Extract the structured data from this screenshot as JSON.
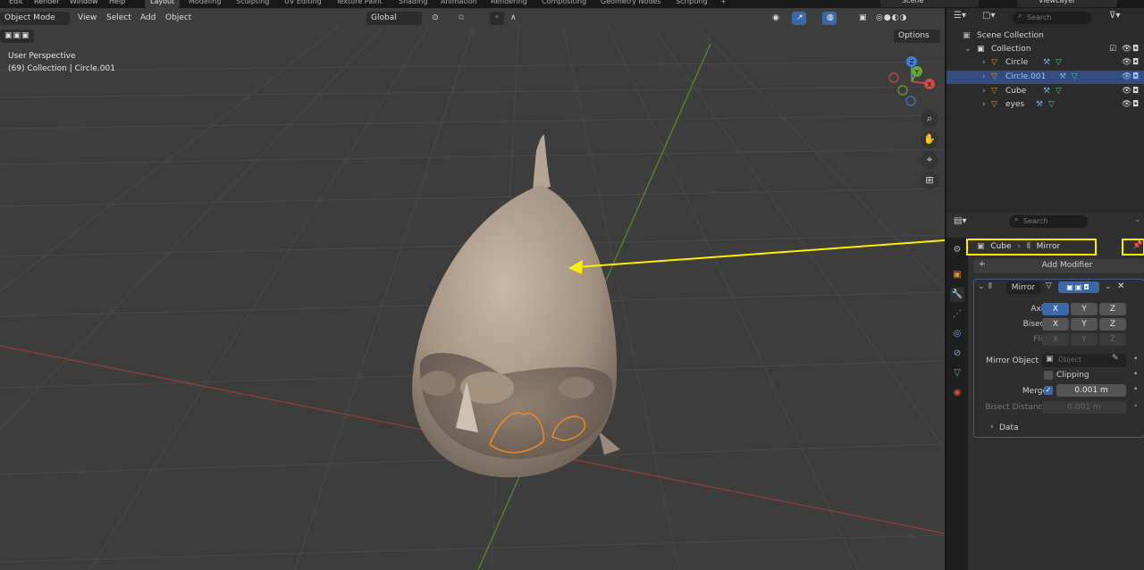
{
  "topbar": {
    "menus": [
      "Edit",
      "Render",
      "Window",
      "Help"
    ],
    "workspaces": [
      "Layout",
      "Modeling",
      "Sculpting",
      "UV Editing",
      "Texture Paint",
      "Shading",
      "Animation",
      "Rendering",
      "Compositing",
      "Geometry Nodes",
      "Scripting",
      "+"
    ],
    "scene": "Scene",
    "view_layer": "ViewLayer"
  },
  "viewport_header": {
    "mode": "Object Mode",
    "menus": [
      "View",
      "Select",
      "Add",
      "Object"
    ],
    "orientation": "Global",
    "options": "Options"
  },
  "viewport_overlay": {
    "perspective": "User Perspective",
    "collection_info": "(69) Collection | Circle.001"
  },
  "gizmo": {
    "x": "X",
    "y": "Y",
    "z": "Z"
  },
  "outliner": {
    "search_placeholder": "Search",
    "scene_collection": "Scene Collection",
    "collection": "Collection",
    "objects": [
      "Circle",
      "Circle.001",
      "Cube",
      "eyes"
    ],
    "selected": "Circle.001"
  },
  "properties": {
    "search_placeholder": "Search",
    "breadcrumb": {
      "object": "Cube",
      "modifier": "Mirror"
    },
    "add_modifier": "Add Modifier",
    "modifier": {
      "name": "Mirror",
      "axis_label": "Axis",
      "bisect_label": "Bisect",
      "flip_label": "Flip",
      "axes": [
        "X",
        "Y",
        "Z"
      ],
      "mirror_object_label": "Mirror Object",
      "mirror_object_placeholder": "Object",
      "clipping_label": "Clipping",
      "merge_label": "Merge",
      "merge_value": "0.001 m",
      "bisect_distance_label": "Bisect Distance",
      "bisect_distance_value": "0.001 m",
      "data_label": "Data"
    }
  },
  "colors": {
    "highlight": "#ffee00",
    "accent_blue": "#3c67a8",
    "selected_row": "#334d80",
    "outline_orange": "#e8892a"
  }
}
